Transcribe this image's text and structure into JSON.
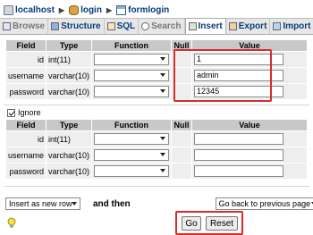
{
  "breadcrumb": [
    "localhost",
    "login",
    "formlogin"
  ],
  "tabs": [
    {
      "label": "Browse",
      "dim": true
    },
    {
      "label": "Structure"
    },
    {
      "label": "SQL"
    },
    {
      "label": "Search",
      "dim": true
    },
    {
      "label": "Insert",
      "active": true
    },
    {
      "label": "Export"
    },
    {
      "label": "Import"
    }
  ],
  "table_headers": [
    "Field",
    "Type",
    "Function",
    "Null",
    "Value"
  ],
  "insert_rows": [
    {
      "field": "id",
      "type": "int(11)",
      "value": "1"
    },
    {
      "field": "username",
      "type": "varchar(10)",
      "value": "admin"
    },
    {
      "field": "password",
      "type": "varchar(10)",
      "value": "12345"
    }
  ],
  "ignore_label": "Ignore",
  "ignore_checked": true,
  "second_rows": [
    {
      "field": "id",
      "type": "int(11)",
      "value": ""
    },
    {
      "field": "username",
      "type": "varchar(10)",
      "value": ""
    },
    {
      "field": "password",
      "type": "varchar(10)",
      "value": ""
    }
  ],
  "footer": {
    "insert_mode": "Insert as new row",
    "and_then_label": "and then",
    "after_action": "Go back to previous page",
    "go_label": "Go",
    "reset_label": "Reset"
  },
  "colors": {
    "highlight": "#d62c2c",
    "header_bg": "#c8c8c8",
    "row_bg": "#eeeeee"
  }
}
